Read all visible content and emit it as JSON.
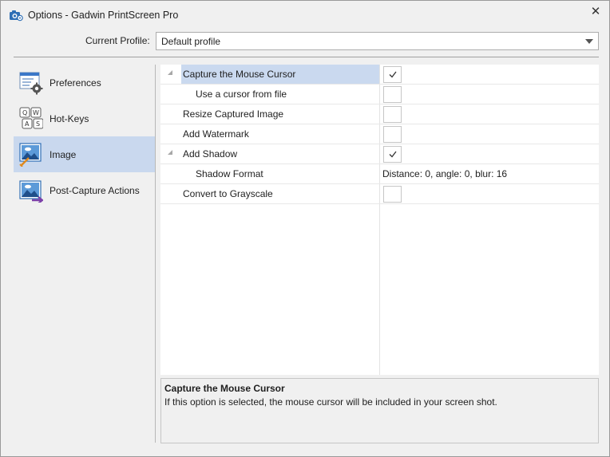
{
  "window": {
    "title": "Options - Gadwin PrintScreen Pro",
    "close_glyph": "✕",
    "app_icon": "camera-settings-icon"
  },
  "profile": {
    "label": "Current Profile:",
    "value": "Default profile"
  },
  "nav": {
    "items": [
      {
        "label": "Preferences",
        "icon": "preferences-gear-icon",
        "selected": false
      },
      {
        "label": "Hot-Keys",
        "icon": "hotkeys-keyboard-icon",
        "selected": false
      },
      {
        "label": "Image",
        "icon": "image-icon",
        "selected": true
      },
      {
        "label": "Post-Capture Actions",
        "icon": "post-capture-icon",
        "selected": false
      }
    ]
  },
  "grid": {
    "rows": [
      {
        "name": "Capture the Mouse Cursor",
        "type": "checkbox",
        "checked": true,
        "expandable": true,
        "selected": true
      },
      {
        "name": "Use a cursor from file",
        "type": "checkbox",
        "checked": false,
        "child": true
      },
      {
        "name": "Resize Captured Image",
        "type": "checkbox",
        "checked": false
      },
      {
        "name": "Add Watermark",
        "type": "checkbox",
        "checked": false
      },
      {
        "name": "Add Shadow",
        "type": "checkbox",
        "checked": true,
        "expandable": true
      },
      {
        "name": "Shadow Format",
        "type": "text",
        "value": "Distance: 0, angle: 0, blur: 16",
        "child": true
      },
      {
        "name": "Convert to Grayscale",
        "type": "checkbox",
        "checked": false
      }
    ]
  },
  "description": {
    "title": "Capture the Mouse Cursor",
    "body": "If this option is selected, the mouse cursor will be included in your screen shot."
  },
  "colors": {
    "selection": "#c9d8ee",
    "window_bg": "#f0f0f0",
    "accent_blue": "#2f6fb5"
  }
}
